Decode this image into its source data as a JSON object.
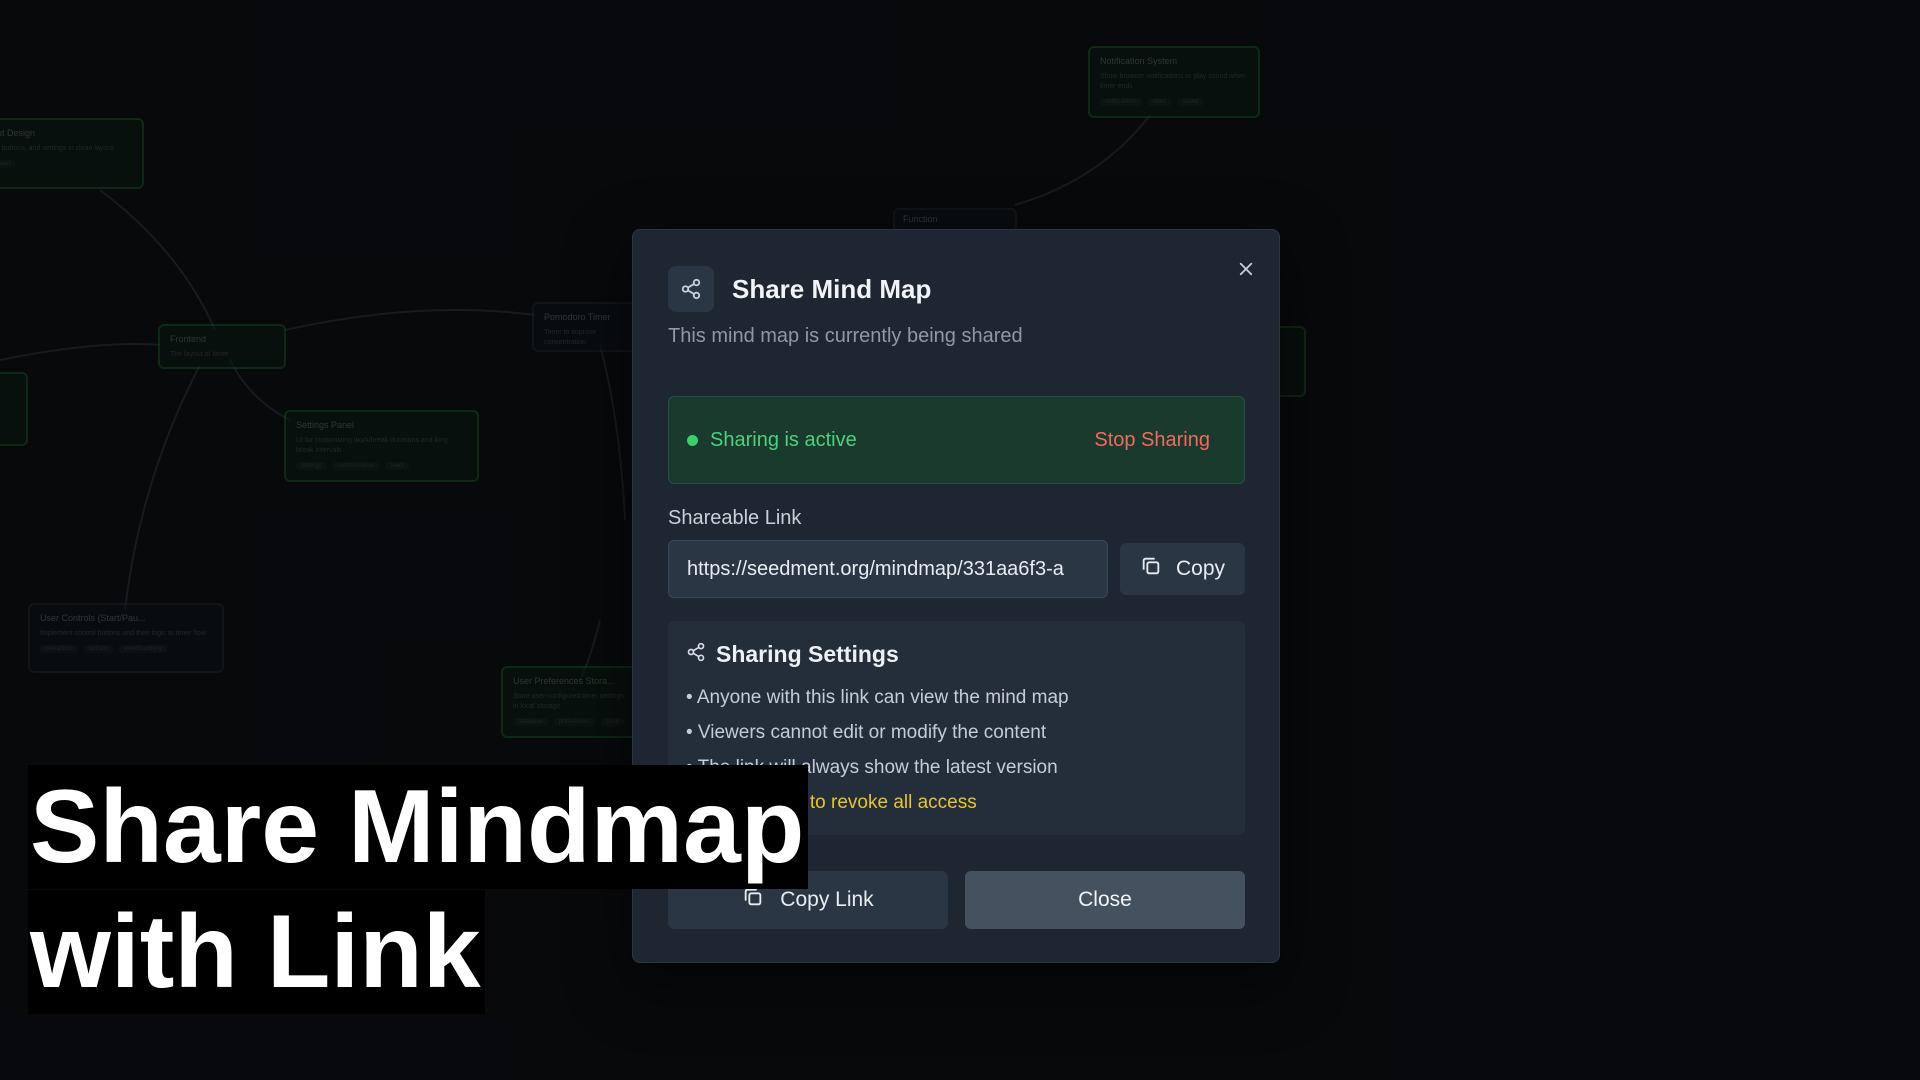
{
  "background_nodes": [
    {
      "title": "out Design",
      "desc": "ar, buttons, and settings in clean layout",
      "tags": [
        "react"
      ],
      "style": "green"
    },
    {
      "title": "Notification System",
      "desc": "Show browser notifications or play sound when timer ends",
      "tags": [
        "notifications",
        "react",
        "sound"
      ],
      "style": "green"
    },
    {
      "title": "Function",
      "desc": "",
      "tags": [],
      "style": "gray"
    },
    {
      "title": "Pomodoro Timer",
      "desc": "Timer to improve concentration",
      "tags": [],
      "style": "gray"
    },
    {
      "title": "Frontend",
      "desc": "The layout of timer",
      "tags": [],
      "style": "green"
    },
    {
      "title": "Settings Panel",
      "desc": "UI for customizing work/break durations and long break intervals",
      "tags": [
        "settings",
        "customization",
        "react"
      ],
      "style": "green"
    },
    {
      "title": "User Controls (Start/Pau...",
      "desc": "Implement control buttons and their logic to timer flow",
      "tags": [
        "interaction",
        "buttons",
        "eventhandling"
      ],
      "style": "gray"
    },
    {
      "title": "User Preferences Stora...",
      "desc": "Store user-configured timer settings in local storage",
      "tags": [
        "database",
        "preferences",
        "local"
      ],
      "style": "green"
    },
    {
      "title": "",
      "desc": "",
      "tags": [],
      "style": "green"
    },
    {
      "title": "",
      "desc": "",
      "tags": [],
      "style": "green"
    }
  ],
  "modal": {
    "title": "Share Mind Map",
    "subtitle": "This mind map is currently being shared",
    "status_text": "Sharing is active",
    "stop_sharing": "Stop Sharing",
    "link_label": "Shareable Link",
    "link_value": "https://seedment.org/mindmap/331aa6f3-a",
    "copy_label": "Copy",
    "settings_title": "Sharing Settings",
    "settings_items": [
      "• Anyone with this link can view the mind map",
      "• Viewers cannot edit or modify the content",
      "• The link will always show the latest version",
      "• Stop sharing to revoke all access"
    ],
    "copy_link_label": "Copy Link",
    "close_label": "Close"
  },
  "colors": {
    "status_green": "#4ed17c",
    "stop_red": "#ee6b5f",
    "warning_yellow": "#e8c431"
  },
  "icons": [
    "share-icon",
    "close-icon",
    "copy-icon"
  ],
  "caption": {
    "line1": "Share Mindmap",
    "line2": "with Link"
  }
}
